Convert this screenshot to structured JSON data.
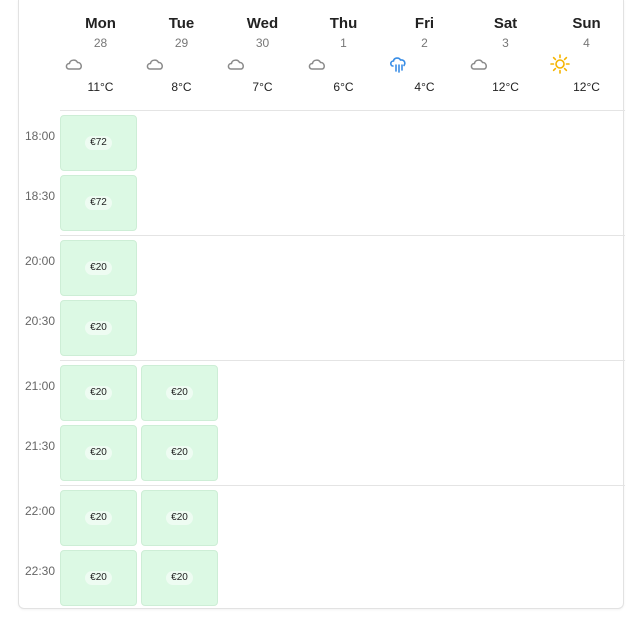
{
  "days": [
    {
      "name": "Mon",
      "date": "28",
      "weather": "cloud-icon",
      "temp": "11°C"
    },
    {
      "name": "Tue",
      "date": "29",
      "weather": "cloud-icon",
      "temp": "8°C"
    },
    {
      "name": "Wed",
      "date": "30",
      "weather": "cloud-icon",
      "temp": "7°C"
    },
    {
      "name": "Thu",
      "date": "1",
      "weather": "cloud-icon",
      "temp": "6°C"
    },
    {
      "name": "Fri",
      "date": "2",
      "weather": "rain-icon",
      "temp": "4°C"
    },
    {
      "name": "Sat",
      "date": "3",
      "weather": "cloud-icon",
      "temp": "12°C"
    },
    {
      "name": "Sun",
      "date": "4",
      "weather": "sun-icon",
      "temp": "12°C"
    }
  ],
  "times": [
    "18:00",
    "18:30",
    "20:00",
    "20:30",
    "21:00",
    "21:30",
    "22:00",
    "22:30"
  ],
  "slots": [
    {
      "time": "18:00",
      "day": "Mon",
      "price": "€72"
    },
    {
      "time": "18:30",
      "day": "Mon",
      "price": "€72"
    },
    {
      "time": "20:00",
      "day": "Mon",
      "price": "€20"
    },
    {
      "time": "20:30",
      "day": "Mon",
      "price": "€20"
    },
    {
      "time": "21:00",
      "day": "Mon",
      "price": "€20"
    },
    {
      "time": "21:00",
      "day": "Tue",
      "price": "€20"
    },
    {
      "time": "21:30",
      "day": "Mon",
      "price": "€20"
    },
    {
      "time": "21:30",
      "day": "Tue",
      "price": "€20"
    },
    {
      "time": "22:00",
      "day": "Mon",
      "price": "€20"
    },
    {
      "time": "22:00",
      "day": "Tue",
      "price": "€20"
    },
    {
      "time": "22:30",
      "day": "Mon",
      "price": "€20"
    },
    {
      "time": "22:30",
      "day": "Tue",
      "price": "€20"
    }
  ],
  "colors": {
    "slot_bg": "#dcf9e4",
    "cloud": "#8a8a8a",
    "rain": "#3a8ee6",
    "sun": "#f5b400"
  }
}
